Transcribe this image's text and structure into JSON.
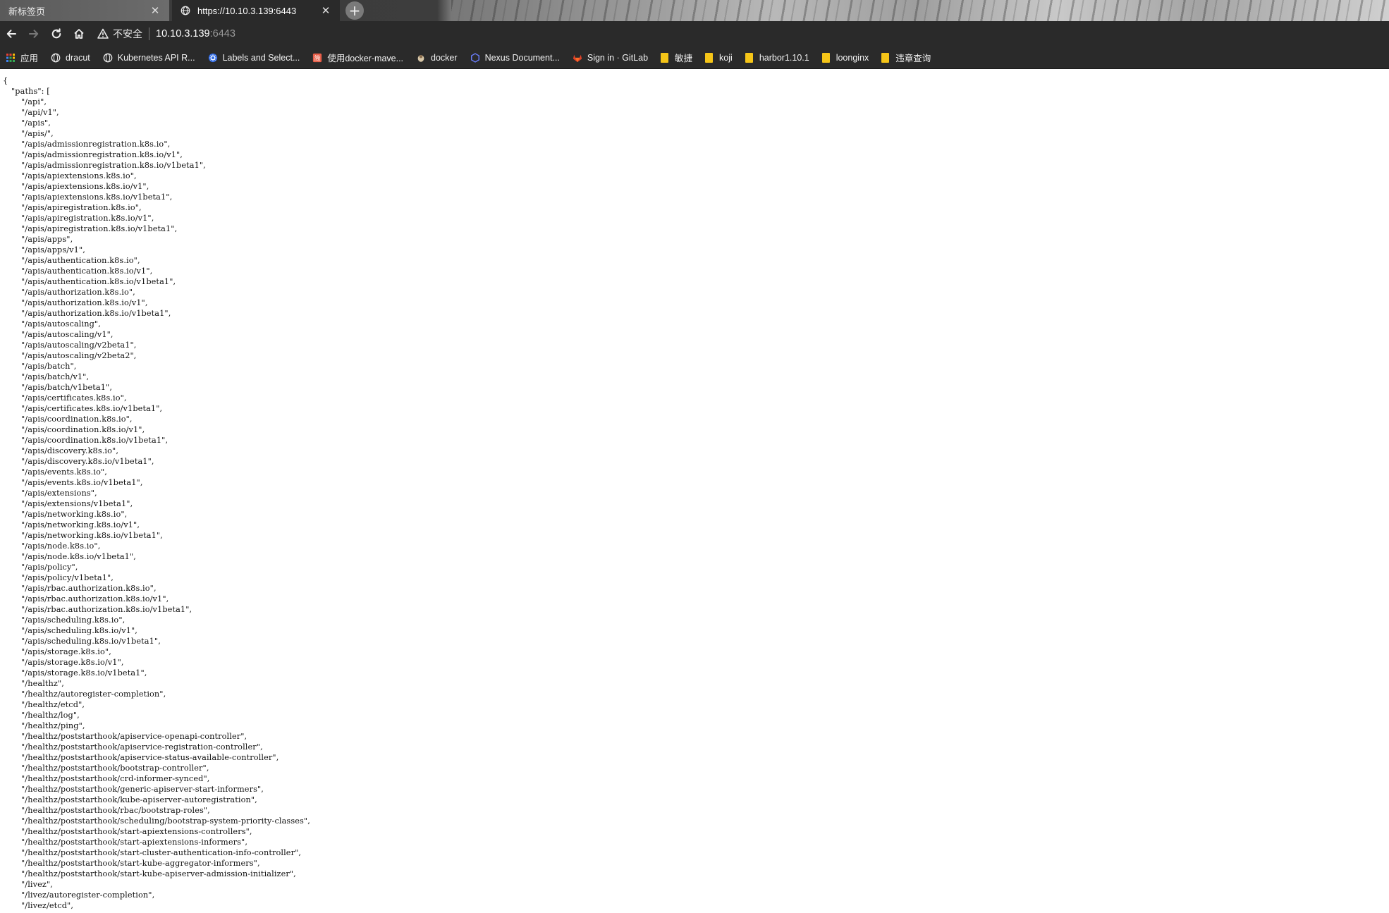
{
  "browser": {
    "tabs": [
      {
        "title": "新标签页",
        "active": false
      },
      {
        "title": "https://10.10.3.139:6443",
        "active": true
      }
    ],
    "address": {
      "security_label": "不安全",
      "host": "10.10.3.139",
      "port": ":6443"
    },
    "bookmarks": [
      {
        "label": "应用",
        "icon": "apps-grid-icon"
      },
      {
        "label": "dracut",
        "icon": "globe-icon"
      },
      {
        "label": "Kubernetes API R...",
        "icon": "globe-icon"
      },
      {
        "label": "Labels and Select...",
        "icon": "kubernetes-icon"
      },
      {
        "label": "使用docker-mave...",
        "icon": "jianshu-icon"
      },
      {
        "label": "docker",
        "icon": "docker-icon"
      },
      {
        "label": "Nexus Document...",
        "icon": "nexus-icon"
      },
      {
        "label": "Sign in · GitLab",
        "icon": "gitlab-icon"
      },
      {
        "label": "敏捷",
        "icon": "folder-icon"
      },
      {
        "label": "koji",
        "icon": "folder-icon"
      },
      {
        "label": "harbor1.10.1",
        "icon": "folder-icon"
      },
      {
        "label": "loonginx",
        "icon": "folder-icon"
      },
      {
        "label": "违章查询",
        "icon": "folder-icon"
      }
    ],
    "colors": {
      "chrome": "#2a2a2a",
      "folder": "#f5c518"
    }
  },
  "json": {
    "open": "{",
    "key_line": "\"paths\": [",
    "paths": [
      "\"/api\",",
      "\"/api/v1\",",
      "\"/apis\",",
      "\"/apis/\",",
      "\"/apis/admissionregistration.k8s.io\",",
      "\"/apis/admissionregistration.k8s.io/v1\",",
      "\"/apis/admissionregistration.k8s.io/v1beta1\",",
      "\"/apis/apiextensions.k8s.io\",",
      "\"/apis/apiextensions.k8s.io/v1\",",
      "\"/apis/apiextensions.k8s.io/v1beta1\",",
      "\"/apis/apiregistration.k8s.io\",",
      "\"/apis/apiregistration.k8s.io/v1\",",
      "\"/apis/apiregistration.k8s.io/v1beta1\",",
      "\"/apis/apps\",",
      "\"/apis/apps/v1\",",
      "\"/apis/authentication.k8s.io\",",
      "\"/apis/authentication.k8s.io/v1\",",
      "\"/apis/authentication.k8s.io/v1beta1\",",
      "\"/apis/authorization.k8s.io\",",
      "\"/apis/authorization.k8s.io/v1\",",
      "\"/apis/authorization.k8s.io/v1beta1\",",
      "\"/apis/autoscaling\",",
      "\"/apis/autoscaling/v1\",",
      "\"/apis/autoscaling/v2beta1\",",
      "\"/apis/autoscaling/v2beta2\",",
      "\"/apis/batch\",",
      "\"/apis/batch/v1\",",
      "\"/apis/batch/v1beta1\",",
      "\"/apis/certificates.k8s.io\",",
      "\"/apis/certificates.k8s.io/v1beta1\",",
      "\"/apis/coordination.k8s.io\",",
      "\"/apis/coordination.k8s.io/v1\",",
      "\"/apis/coordination.k8s.io/v1beta1\",",
      "\"/apis/discovery.k8s.io\",",
      "\"/apis/discovery.k8s.io/v1beta1\",",
      "\"/apis/events.k8s.io\",",
      "\"/apis/events.k8s.io/v1beta1\",",
      "\"/apis/extensions\",",
      "\"/apis/extensions/v1beta1\",",
      "\"/apis/networking.k8s.io\",",
      "\"/apis/networking.k8s.io/v1\",",
      "\"/apis/networking.k8s.io/v1beta1\",",
      "\"/apis/node.k8s.io\",",
      "\"/apis/node.k8s.io/v1beta1\",",
      "\"/apis/policy\",",
      "\"/apis/policy/v1beta1\",",
      "\"/apis/rbac.authorization.k8s.io\",",
      "\"/apis/rbac.authorization.k8s.io/v1\",",
      "\"/apis/rbac.authorization.k8s.io/v1beta1\",",
      "\"/apis/scheduling.k8s.io\",",
      "\"/apis/scheduling.k8s.io/v1\",",
      "\"/apis/scheduling.k8s.io/v1beta1\",",
      "\"/apis/storage.k8s.io\",",
      "\"/apis/storage.k8s.io/v1\",",
      "\"/apis/storage.k8s.io/v1beta1\",",
      "\"/healthz\",",
      "\"/healthz/autoregister-completion\",",
      "\"/healthz/etcd\",",
      "\"/healthz/log\",",
      "\"/healthz/ping\",",
      "\"/healthz/poststarthook/apiservice-openapi-controller\",",
      "\"/healthz/poststarthook/apiservice-registration-controller\",",
      "\"/healthz/poststarthook/apiservice-status-available-controller\",",
      "\"/healthz/poststarthook/bootstrap-controller\",",
      "\"/healthz/poststarthook/crd-informer-synced\",",
      "\"/healthz/poststarthook/generic-apiserver-start-informers\",",
      "\"/healthz/poststarthook/kube-apiserver-autoregistration\",",
      "\"/healthz/poststarthook/rbac/bootstrap-roles\",",
      "\"/healthz/poststarthook/scheduling/bootstrap-system-priority-classes\",",
      "\"/healthz/poststarthook/start-apiextensions-controllers\",",
      "\"/healthz/poststarthook/start-apiextensions-informers\",",
      "\"/healthz/poststarthook/start-cluster-authentication-info-controller\",",
      "\"/healthz/poststarthook/start-kube-aggregator-informers\",",
      "\"/healthz/poststarthook/start-kube-apiserver-admission-initializer\",",
      "\"/livez\",",
      "\"/livez/autoregister-completion\",",
      "\"/livez/etcd\","
    ]
  }
}
